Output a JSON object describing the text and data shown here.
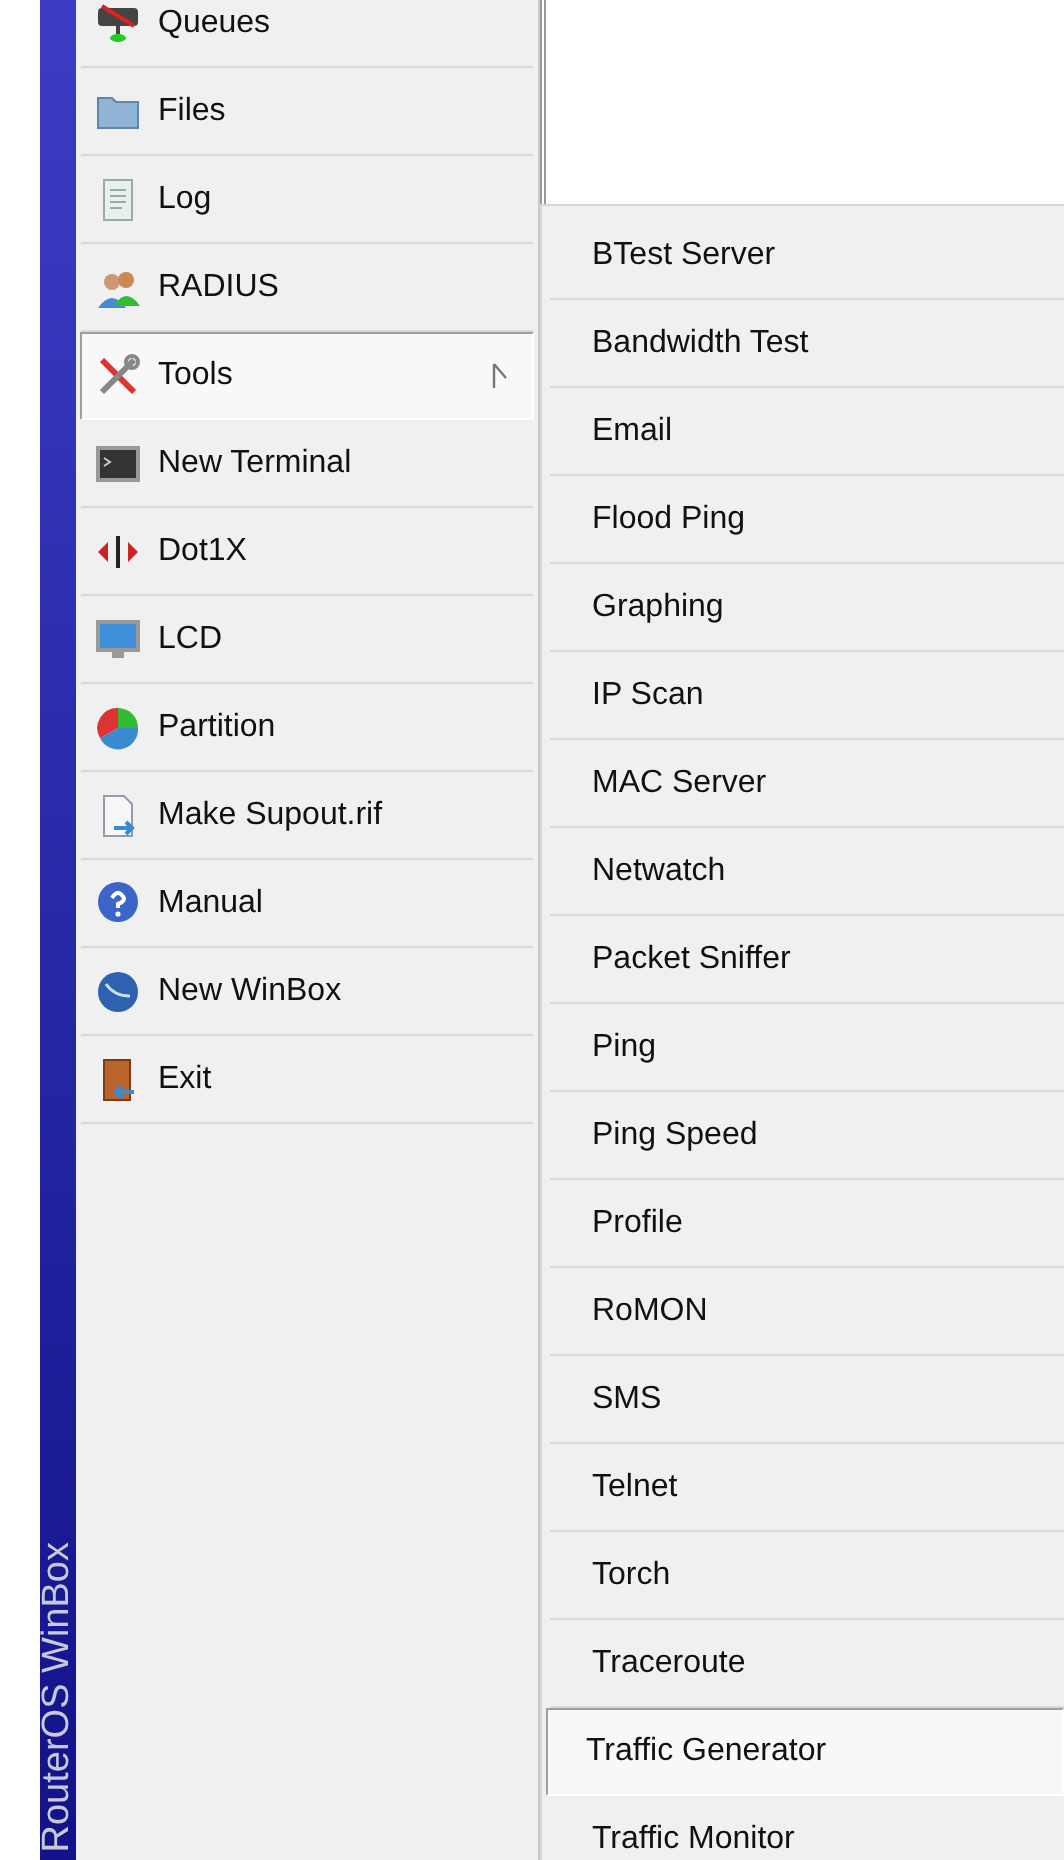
{
  "side_banner": {
    "text": "RouterOS WinBox"
  },
  "menu": {
    "items": [
      {
        "label": "Queues",
        "selected": false,
        "submenu": false
      },
      {
        "label": "Files",
        "selected": false,
        "submenu": false
      },
      {
        "label": "Log",
        "selected": false,
        "submenu": false
      },
      {
        "label": "RADIUS",
        "selected": false,
        "submenu": false
      },
      {
        "label": "Tools",
        "selected": true,
        "submenu": true
      },
      {
        "label": "New Terminal",
        "selected": false,
        "submenu": false
      },
      {
        "label": "Dot1X",
        "selected": false,
        "submenu": false
      },
      {
        "label": "LCD",
        "selected": false,
        "submenu": false
      },
      {
        "label": "Partition",
        "selected": false,
        "submenu": false
      },
      {
        "label": "Make Supout.rif",
        "selected": false,
        "submenu": false
      },
      {
        "label": "Manual",
        "selected": false,
        "submenu": false
      },
      {
        "label": "New WinBox",
        "selected": false,
        "submenu": false
      },
      {
        "label": "Exit",
        "selected": false,
        "submenu": false
      }
    ]
  },
  "submenu": {
    "items": [
      {
        "label": "BTest Server",
        "selected": false
      },
      {
        "label": "Bandwidth Test",
        "selected": false
      },
      {
        "label": "Email",
        "selected": false
      },
      {
        "label": "Flood Ping",
        "selected": false
      },
      {
        "label": "Graphing",
        "selected": false
      },
      {
        "label": "IP Scan",
        "selected": false
      },
      {
        "label": "MAC Server",
        "selected": false
      },
      {
        "label": "Netwatch",
        "selected": false
      },
      {
        "label": "Packet Sniffer",
        "selected": false
      },
      {
        "label": "Ping",
        "selected": false
      },
      {
        "label": "Ping Speed",
        "selected": false
      },
      {
        "label": "Profile",
        "selected": false
      },
      {
        "label": "RoMON",
        "selected": false
      },
      {
        "label": "SMS",
        "selected": false
      },
      {
        "label": "Telnet",
        "selected": false
      },
      {
        "label": "Torch",
        "selected": false
      },
      {
        "label": "Traceroute",
        "selected": false
      },
      {
        "label": "Traffic Generator",
        "selected": true
      },
      {
        "label": "Traffic Monitor",
        "selected": false
      }
    ]
  }
}
